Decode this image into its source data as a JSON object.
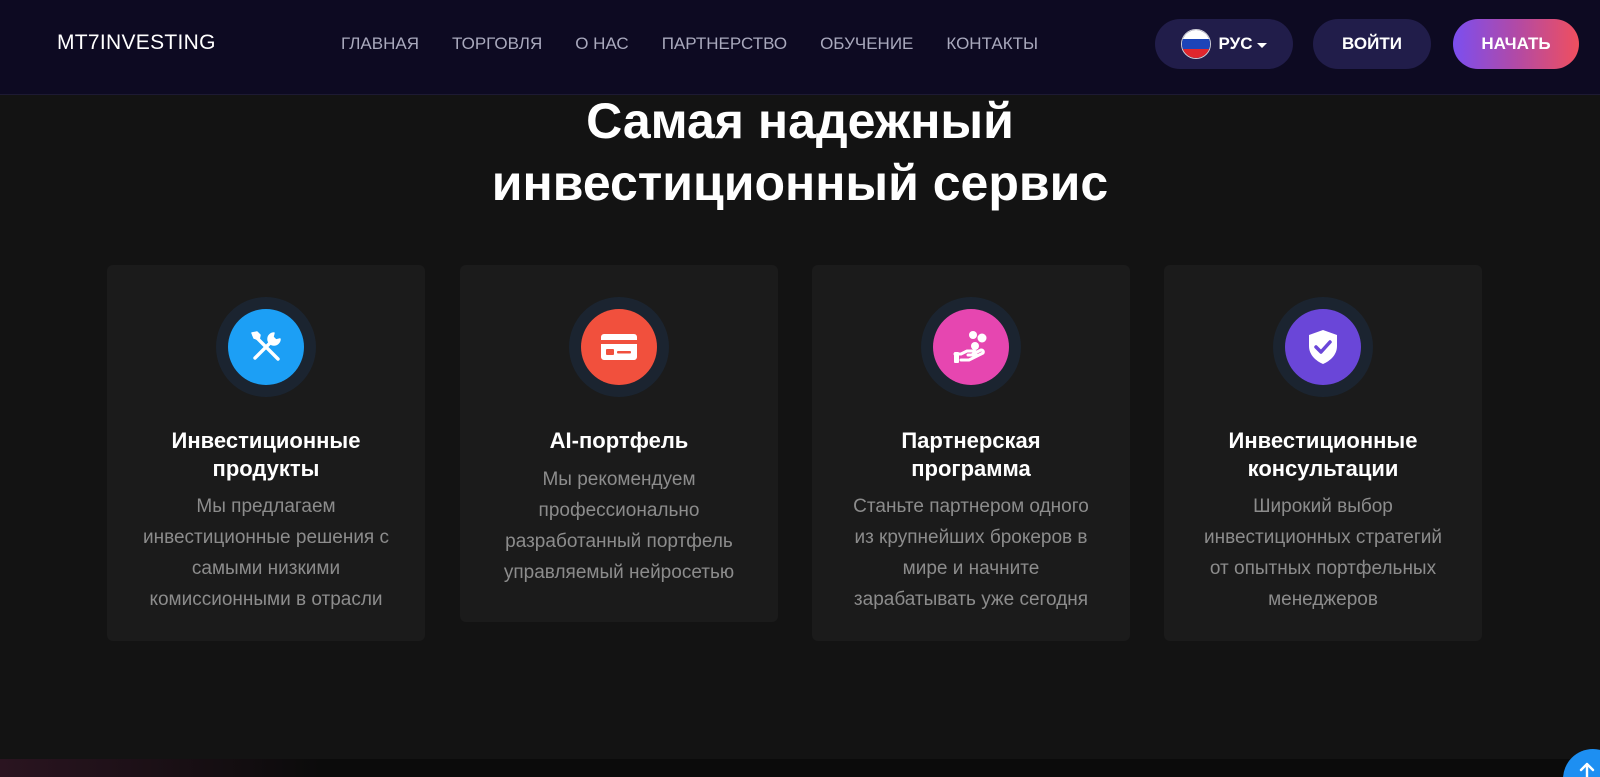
{
  "brand": {
    "name": "MT7INVESTING"
  },
  "nav": {
    "items": [
      {
        "label": "ГЛАВНАЯ"
      },
      {
        "label": "ТОРГОВЛЯ"
      },
      {
        "label": "О НАС"
      },
      {
        "label": "ПАРТНЕРСТВО"
      },
      {
        "label": "ОБУЧЕНИЕ"
      },
      {
        "label": "КОНТАКТЫ"
      }
    ]
  },
  "header": {
    "language_label": "РУС",
    "login_label": "ВОЙТИ",
    "start_label": "НАЧАТЬ"
  },
  "hero": {
    "title_line1": "Самая надежный",
    "title_line2": "инвестиционный сервис"
  },
  "features": [
    {
      "icon": "tools-icon",
      "icon_color": "#1c9ff5",
      "title": [
        "Инвестиционные",
        "продукты"
      ],
      "text": [
        "Мы предлагаем",
        "инвестиционные решения с",
        "самыми низкими",
        "комиссионными в отрасли"
      ]
    },
    {
      "icon": "credit-card-icon",
      "icon_color": "#f1503d",
      "title": [
        "AI-портфель"
      ],
      "text": [
        "Мы рекомендуем",
        "профессионально",
        "разработанный портфель",
        "управляемый нейросетью"
      ]
    },
    {
      "icon": "hand-coins-icon",
      "icon_color": "#e646b0",
      "title": [
        "Партнерская",
        "программа"
      ],
      "text": [
        "Станьте партнером одного",
        "из крупнейших брокеров в",
        "мире и начните",
        "зарабатывать уже сегодня"
      ]
    },
    {
      "icon": "shield-check-icon",
      "icon_color": "#6a46d8",
      "title": [
        "Инвестиционные",
        "консультации"
      ],
      "text": [
        "Широкий выбор",
        "инвестиционных стратегий",
        "от опытных портфельных",
        "менеджеров"
      ]
    }
  ],
  "colors": {
    "header_bg": "#0d0a22",
    "page_bg": "#131313",
    "card_bg": "#1b1b1b",
    "pill_bg": "#211d4a",
    "accent_gradient_start": "#7b4ef0",
    "accent_gradient_end": "#f04f5e",
    "scroll_button": "#1d8ff2"
  }
}
